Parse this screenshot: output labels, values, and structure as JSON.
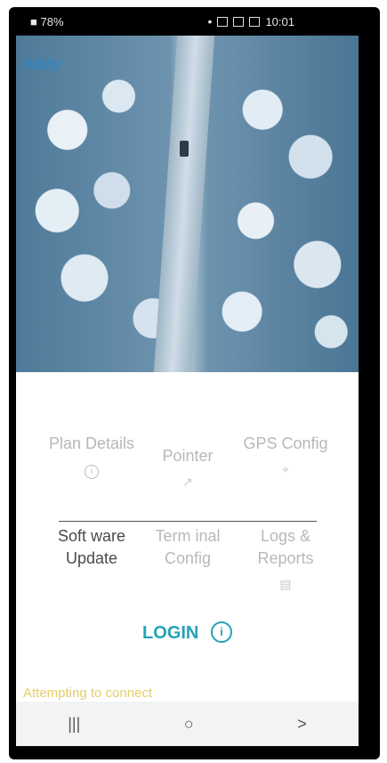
{
  "status_bar": {
    "battery": "78%",
    "time": "10:01"
  },
  "app": {
    "logo": "hiSky"
  },
  "menu": {
    "plan_details": "Plan Details",
    "pointer": "Pointer",
    "gps_config": "GPS Config",
    "software_update": "Soft ware Update",
    "terminal_config": "Term inal Config",
    "logs_reports": "Logs & Reports"
  },
  "login": {
    "label": "LOGIN"
  },
  "status_message": "Attempting to connect",
  "nav": {
    "recent_icon": "|||",
    "home_icon": "○",
    "back_icon": ">"
  },
  "colors": {
    "accent": "#25a3b4",
    "status_text": "#e4cf6a",
    "logo": "#2f86c3"
  }
}
